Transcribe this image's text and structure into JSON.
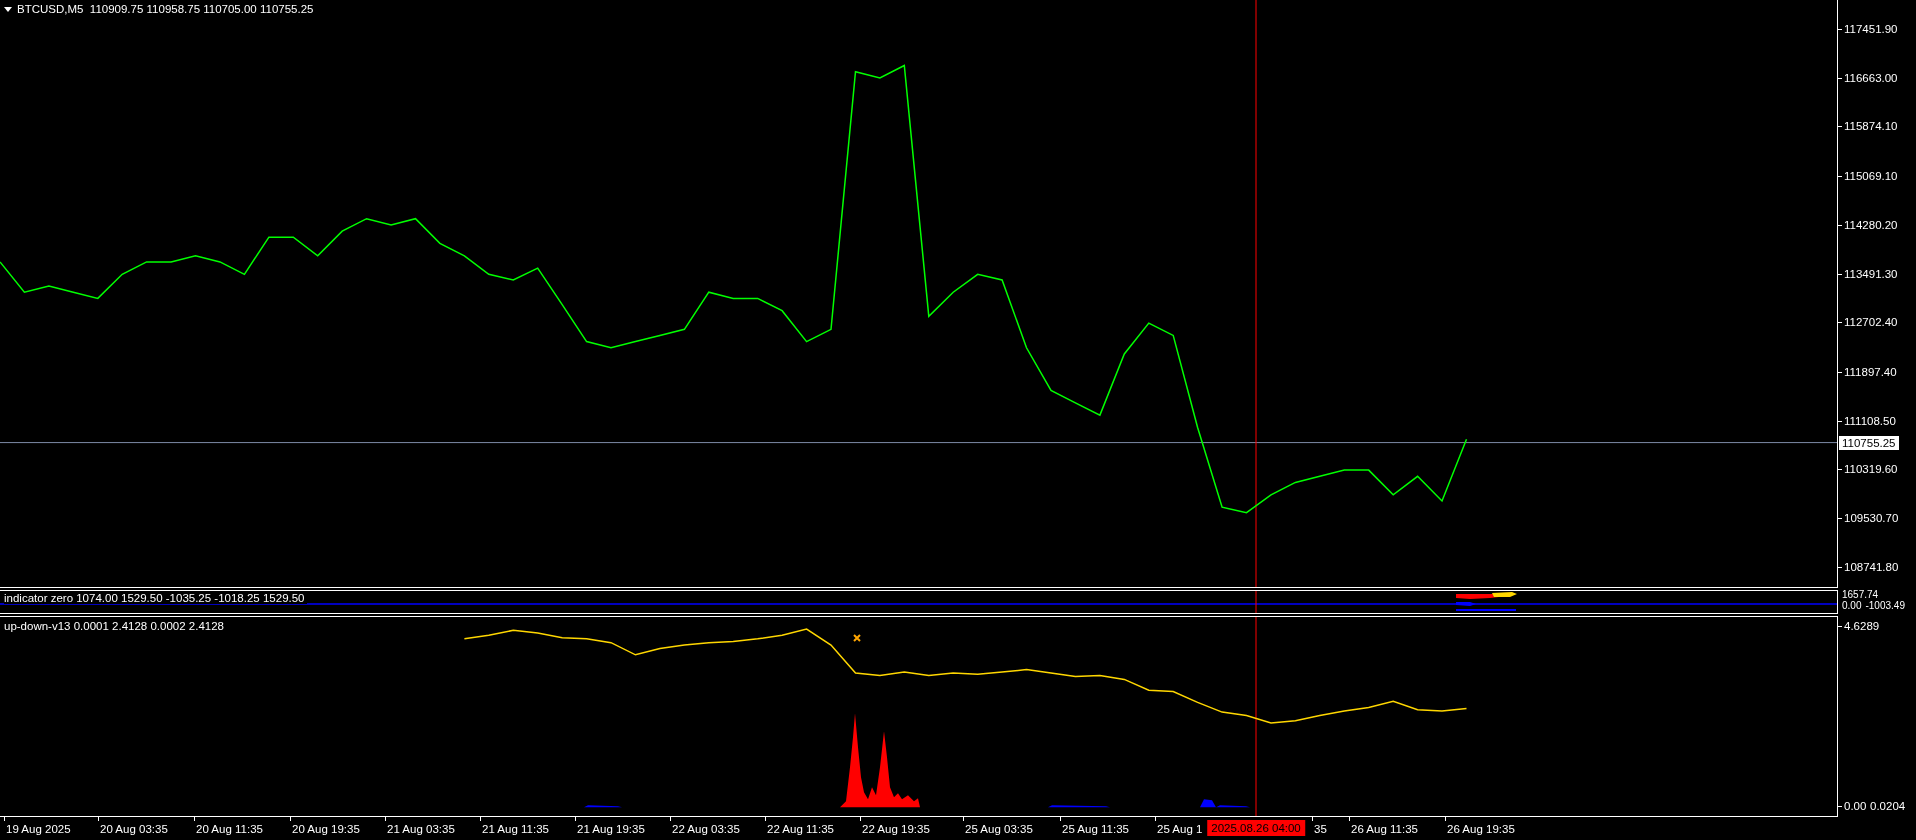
{
  "main_chart": {
    "quotes": "110909.75 110958.75 110705.00 110755.25",
    "chart_data": {
      "type": "line",
      "ylim": [
        108401,
        117921
      ],
      "yticks": [
        {
          "value": 117451.9,
          "label": "117451.90"
        },
        {
          "value": 116663.0,
          "label": "116663.00"
        },
        {
          "value": 115874.1,
          "label": "115874.10"
        },
        {
          "value": 115069.1,
          "label": "115069.10"
        },
        {
          "value": 114280.2,
          "label": "114280.20"
        },
        {
          "value": 113491.3,
          "label": "113491.30"
        },
        {
          "value": 112702.4,
          "label": "112702.40"
        },
        {
          "value": 111897.4,
          "label": "111897.40"
        },
        {
          "value": 111108.5,
          "label": "111108.50"
        },
        {
          "value": 110319.6,
          "label": "110319.60"
        },
        {
          "value": 109530.7,
          "label": "109530.70"
        },
        {
          "value": 108741.8,
          "label": "108741.80"
        }
      ],
      "series": [
        {
          "name": "BTCUSD,M5",
          "color": "#00ff00",
          "values": [
            113680,
            113190,
            113290,
            113190,
            113090,
            113480,
            113680,
            113680,
            113780,
            113680,
            113480,
            114080,
            114080,
            113780,
            114180,
            114380,
            114280,
            114380,
            113980,
            113780,
            113480,
            113390,
            113580,
            112990,
            112390,
            112290,
            112390,
            112490,
            112590,
            113190,
            113090,
            113090,
            112890,
            112390,
            112590,
            116760,
            116660,
            116860,
            112800,
            113190,
            113480,
            113390,
            112290,
            111600,
            111400,
            111200,
            112190,
            112690,
            112490,
            111000,
            109710,
            109620,
            109910,
            110110,
            110210,
            110310,
            110310,
            109910,
            110210,
            109810,
            110810
          ]
        }
      ],
      "ref_lines": [
        {
          "axis": "y",
          "value": 110755.25,
          "label": "110755.25"
        }
      ]
    }
  },
  "indicator_zero": {
    "title": "indicator zero 1074.00 1529.50 -1035.25 -1018.25 1529.50",
    "axis_labels": [
      "1657.74",
      "0.00",
      "-1003.49"
    ]
  },
  "up_down": {
    "values_text": "0.0001 2.4128 0.0002 2.4128",
    "axis_extra": "0.0204",
    "chart_data": {
      "type": "line",
      "ylim": [
        -0.25,
        4.88
      ],
      "yticks": [
        {
          "value": 4.6289,
          "label": "4.6289"
        },
        {
          "value": 0,
          "label": "0.00"
        }
      ],
      "series": [
        {
          "name": "up-down-v13",
          "color": "#ffd700",
          "values": [
            null,
            null,
            null,
            null,
            null,
            null,
            null,
            null,
            null,
            null,
            null,
            null,
            null,
            null,
            null,
            null,
            null,
            null,
            null,
            4.32,
            4.41,
            4.54,
            4.47,
            4.35,
            4.32,
            4.22,
            3.91,
            4.07,
            4.16,
            4.22,
            4.25,
            4.32,
            4.41,
            4.57,
            4.16,
            3.44,
            3.38,
            3.47,
            3.38,
            3.44,
            3.41,
            3.47,
            3.53,
            3.44,
            3.35,
            3.38,
            3.28,
            3.0,
            2.97,
            2.69,
            2.44,
            2.35,
            2.16,
            2.22,
            2.35,
            2.47,
            2.56,
            2.72,
            2.5,
            2.47,
            2.53
          ]
        }
      ]
    }
  },
  "time_axis": {
    "labels": [
      "19 Aug 2025",
      "20 Aug 03:35",
      "20 Aug 11:35",
      "20 Aug 19:35",
      "21 Aug 03:35",
      "21 Aug 11:35",
      "21 Aug 19:35",
      "22 Aug 03:35",
      "22 Aug 11:35",
      "22 Aug 19:35",
      "25 Aug 03:35",
      "25 Aug 11:35",
      "25 Aug 1",
      "35",
      "26 Aug 11:35",
      "26 Aug 19:35"
    ],
    "cursor_label": "2025.08.26 04:00"
  }
}
